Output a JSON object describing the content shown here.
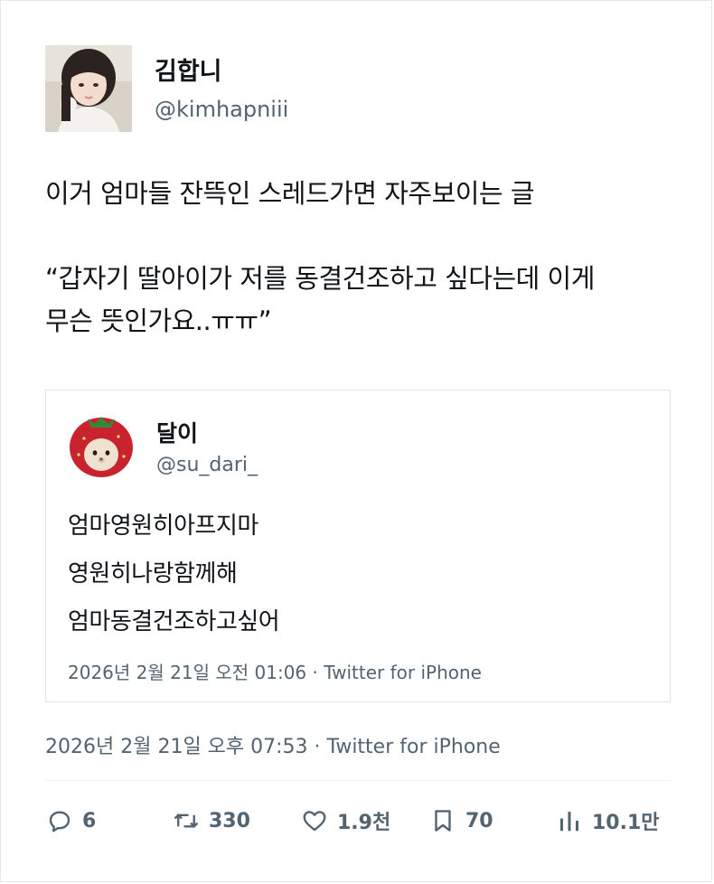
{
  "author": {
    "name": "김합니",
    "handle": "@kimhapniii"
  },
  "tweet": {
    "lines": [
      "이거 엄마들 잔뜩인 스레드가면 자주보이는 글",
      "“갑자기 딸아이가 저를 동결건조하고 싶다는데 이게",
      "무슨 뜻인가요..ㅠㅠ”"
    ],
    "meta": "2026년 2월 21일 오후 07:53 · Twitter for iPhone"
  },
  "quoted": {
    "name": "달이",
    "handle": "@su_dari_",
    "lines": [
      "엄마영원히아프지마",
      "영원히나랑함께해",
      "엄마동결건조하고싶어"
    ],
    "meta": "2026년 2월 21일 오전 01:06 · Twitter for iPhone"
  },
  "actions": {
    "replies": "6",
    "retweets": "330",
    "likes": "1.9천",
    "bookmarks": "70",
    "views": "10.1만"
  },
  "icons": {
    "reply": "speech-bubble-icon",
    "retweet": "retweet-arrows-icon",
    "like": "heart-icon",
    "bookmark": "bookmark-icon",
    "views": "bar-chart-icon"
  },
  "colors": {
    "text": "#0f1419",
    "secondary": "#536471",
    "border": "#e1e4e6"
  }
}
